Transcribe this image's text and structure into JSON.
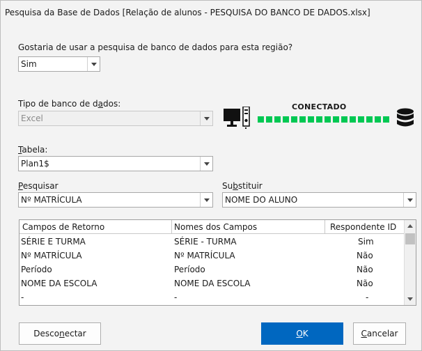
{
  "window": {
    "title": "Pesquisa da Base de Dados [Relação de alunos - PESQUISA DO BANCO DE DADOS.xlsx]"
  },
  "region_question": {
    "label": "Gostaria de usar a pesquisa de banco de dados para esta região?",
    "value": "Sim"
  },
  "db_type": {
    "label_pre": "Tipo de banco de d",
    "label_key": "a",
    "label_post": "dos:",
    "value": "Excel",
    "disabled": true
  },
  "connection": {
    "status": "CONECTADO",
    "color": "#00c853",
    "computer_icon": "computer-icon",
    "database_icon": "database-icon"
  },
  "table": {
    "label_key": "T",
    "label_post": "abela:",
    "value": "Plan1$"
  },
  "search": {
    "label_key": "P",
    "label_post": "esquisar",
    "value": "Nº MATRÍCULA"
  },
  "replace": {
    "label_pre": "Su",
    "label_key": "b",
    "label_post": "stituir",
    "value": "NOME DO ALUNO"
  },
  "grid": {
    "headers": [
      "Campos de Retorno",
      "Nomes dos Campos",
      "Respondente ID"
    ],
    "rows": [
      [
        "SÉRIE E TURMA",
        "SÉRIE - TURMA",
        "Sim"
      ],
      [
        "Nº MATRÍCULA",
        "Nº MATRÍCULA",
        "Não"
      ],
      [
        "Período",
        "Período",
        "Não"
      ],
      [
        "NOME DA ESCOLA",
        "NOME DA ESCOLA",
        "Não"
      ],
      [
        "-",
        "-",
        "-"
      ]
    ]
  },
  "buttons": {
    "disconnect": {
      "pre": "Desco",
      "key": "n",
      "post": "ectar"
    },
    "ok": {
      "key": "O",
      "post": "K"
    },
    "cancel": {
      "key": "C",
      "post": "ancelar"
    }
  },
  "colors": {
    "accent": "#0067c0",
    "connected": "#00c853"
  }
}
